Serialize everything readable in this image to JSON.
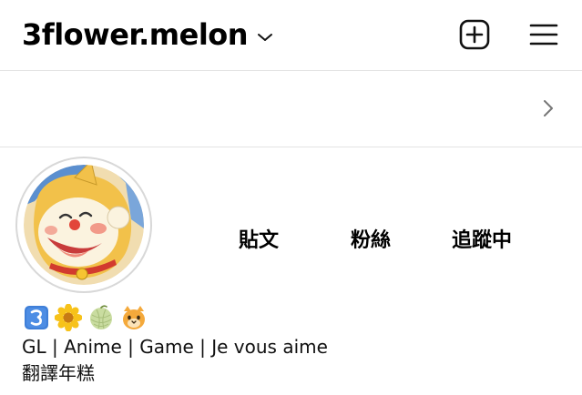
{
  "header": {
    "username": "3flower.melon",
    "icons": [
      "chevron-down-icon",
      "add-post-icon",
      "menu-icon"
    ]
  },
  "banner": {
    "icons": [
      "chevron-right-icon"
    ]
  },
  "profile": {
    "avatar_icon": "doraemon-avatar",
    "stats": {
      "posts_label": "貼文",
      "followers_label": "粉絲",
      "following_label": "追蹤中"
    }
  },
  "bio": {
    "emojis": [
      "keycap-three-emoji",
      "sunflower-emoji",
      "melon-emoji",
      "cat-face-emoji"
    ],
    "line1": "GL | Anime | Game | Je vous aime",
    "line2": "翻譯年糕"
  },
  "colors": {
    "text": "#000000",
    "divider": "#e3e3e3",
    "keycap_blue": "#3f7fd8",
    "sunflower_yellow": "#f7c21a",
    "melon_green": "#c9dca0",
    "cat_orange": "#f4a93b"
  }
}
